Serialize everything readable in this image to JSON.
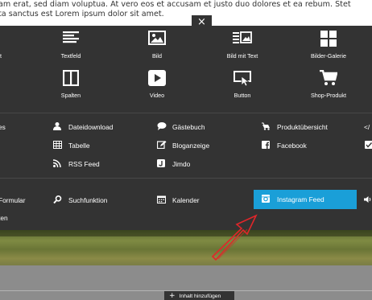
{
  "page_text": {
    "line1": "am erat, sed diam voluptua. At vero eos et accusam et justo duo dolores et ea rebum. Stet",
    "line2": "ta sanctus est Lorem ipsum dolor sit amet."
  },
  "close_label": "×",
  "elements_row1": [
    {
      "label": "t",
      "icon": "text-icon"
    },
    {
      "label": "Textfeld",
      "icon": "textfield-icon"
    },
    {
      "label": "Bild",
      "icon": "image-icon"
    },
    {
      "label": "Bild mit Text",
      "icon": "image-with-text-icon"
    },
    {
      "label": "Bilder-Galerie",
      "icon": "gallery-icon"
    }
  ],
  "elements_row2": [
    {
      "label": "Spalten",
      "icon": "columns-icon"
    },
    {
      "label": "Video",
      "icon": "video-icon"
    },
    {
      "label": "Button",
      "icon": "button-icon"
    },
    {
      "label": "Shop-Produkt",
      "icon": "cart-icon"
    }
  ],
  "list_col0": [
    {
      "label": "es"
    }
  ],
  "list_col1": [
    {
      "label": "Dateidownload",
      "icon": "download-user-icon"
    },
    {
      "label": "Tabelle",
      "icon": "table-icon"
    },
    {
      "label": "RSS Feed",
      "icon": "rss-icon"
    }
  ],
  "list_col2": [
    {
      "label": "Gästebuch",
      "icon": "speech-bubble-icon"
    },
    {
      "label": "Bloganzeige",
      "icon": "edit-icon"
    },
    {
      "label": "Jimdo",
      "icon": "jimdo-icon"
    }
  ],
  "list_col3": [
    {
      "label": "Produktübersicht",
      "icon": "car-icon"
    },
    {
      "label": "Facebook",
      "icon": "facebook-icon"
    }
  ],
  "list_col4": [
    {
      "label": "</",
      "icon": "code-icon"
    },
    {
      "label": "",
      "icon": "check-icon"
    }
  ],
  "bottom_items": {
    "formular": "Formular",
    "formular_sub": "ten",
    "suchfunktion": "Suchfunktion",
    "kalender": "Kalender",
    "instagram": "Instagram Feed"
  },
  "add_content_label": "Inhalt hinzufügen",
  "colors": {
    "panel": "#333333",
    "accent": "#1a9fd8",
    "arrow": "#e0262a"
  }
}
